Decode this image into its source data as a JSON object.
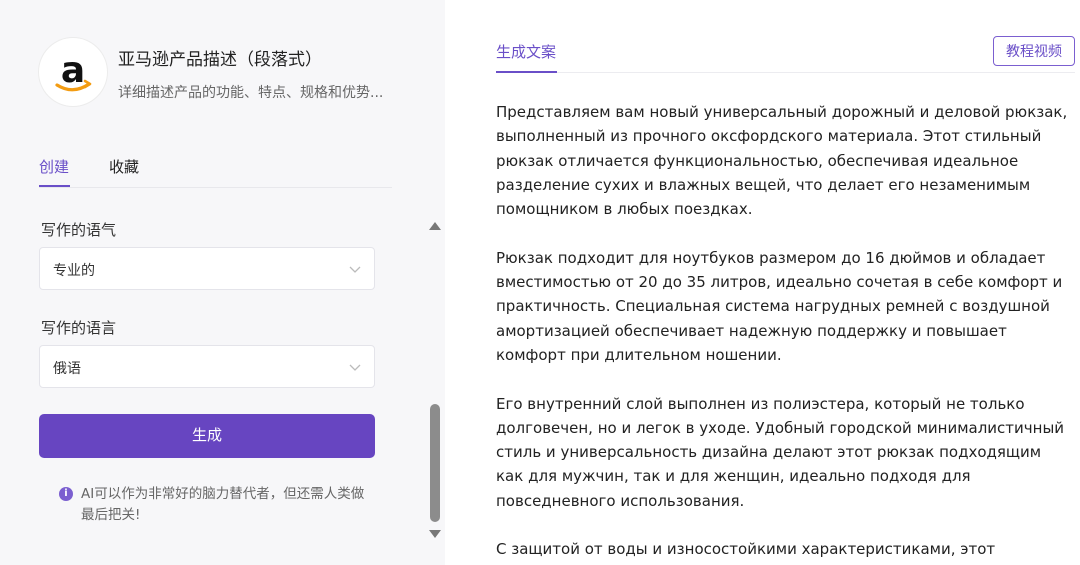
{
  "app": {
    "title": "亚马逊产品描述（段落式）",
    "description": "详细描述产品的功能、特点、规格和优势...",
    "logo_icon": "amazon-logo-icon"
  },
  "tabs": {
    "create": "创建",
    "favorites": "收藏"
  },
  "form": {
    "tone_label": "写作的语气",
    "tone_value": "专业的",
    "language_label": "写作的语言",
    "language_value": "俄语",
    "generate_label": "生成",
    "tip_icon": "info-icon",
    "tip_text": "AI可以作为非常好的脑力替代者，但还需人类做最后把关!"
  },
  "result": {
    "tab_label": "生成文案",
    "tutorial_label": "教程视频",
    "paragraphs": [
      "Представляем вам новый универсальный дорожный и деловой рюкзак, выполненный из прочного оксфордского материала. Этот стильный рюкзак отличается функциональностью, обеспечивая идеальное разделение сухих и влажных вещей, что делает его незаменимым помощником в любых поездках.",
      "Рюкзак подходит для ноутбуков размером до 16 дюймов и обладает вместимостью от 20 до 35 литров, идеально сочетая в себе комфорт и практичность. Специальная система нагрудных ремней с воздушной амортизацией обеспечивает надежную поддержку и повышает комфорт при длительном ношении.",
      "Его внутренний слой выполнен из полиэстера, который не только долговечен, но и легок в уходе. Удобный городской минималистичный стиль и универсальность дизайна делают этот рюкзак подходящим как для мужчин, так и для женщин, идеально подходя для повседневного использования.",
      "С защитой от воды и износостойкими характеристиками, этот"
    ]
  },
  "colors": {
    "accent": "#6745c1",
    "accent_text": "#6a4fc8",
    "panel_bg": "#f7f7f9"
  }
}
